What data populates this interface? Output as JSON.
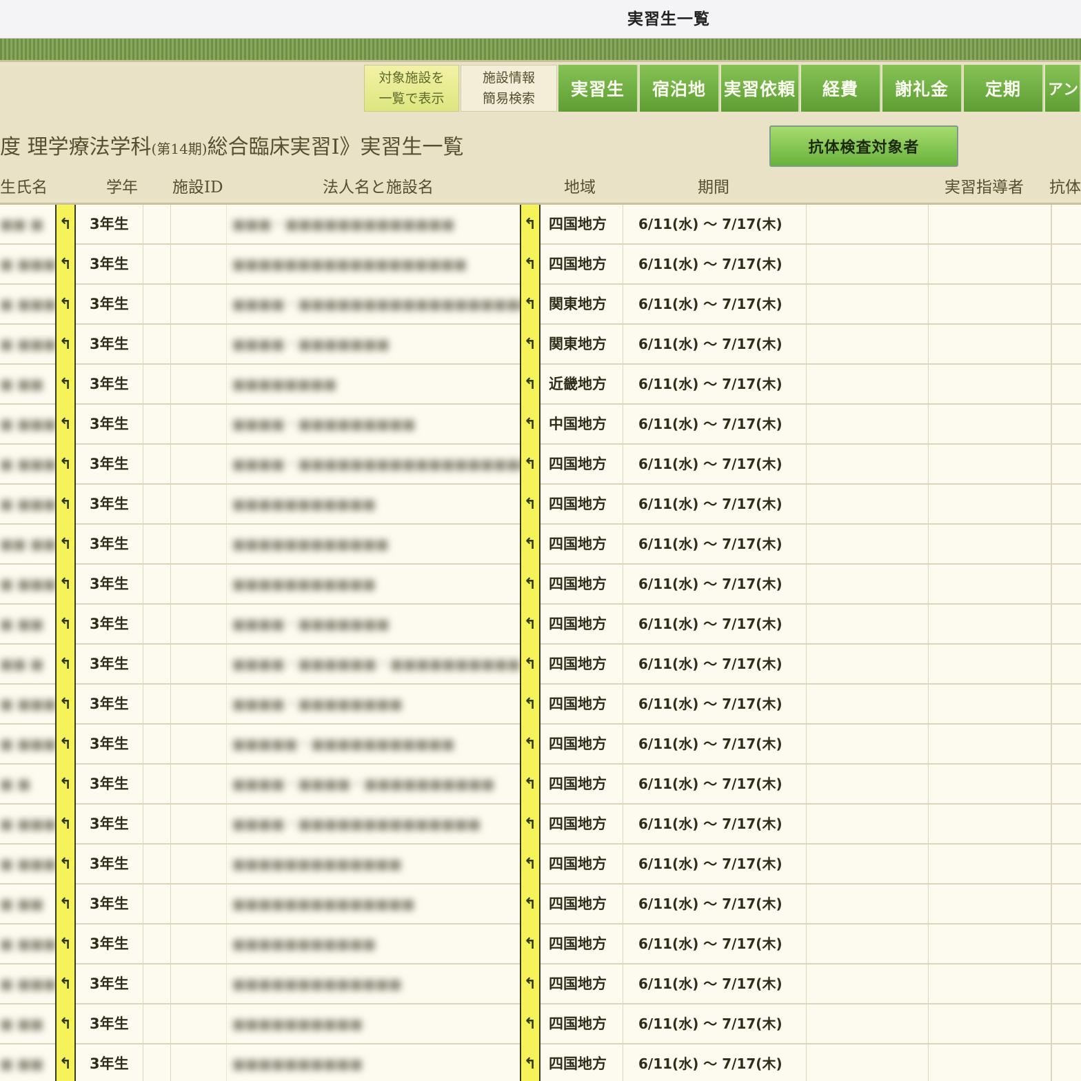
{
  "window": {
    "title": "実習生一覧"
  },
  "nav": {
    "list_facilities": "対象施設を\n一覧で表示",
    "facility_search": "施設情報\n簡易検索",
    "tabs": [
      "実習生",
      "宿泊地",
      "実習依頼",
      "経費",
      "謝礼金",
      "定期",
      "アンケ"
    ]
  },
  "heading": {
    "left": "度 理学療法学科",
    "term": "(第14期)",
    "right": "総合臨床実習Ⅰ》実習生一覧"
  },
  "antibody_button": "抗体検査対象者",
  "columns": {
    "name": "生氏名",
    "grade": "学年",
    "facility_id": "施設ID",
    "facility": "法人名と施設名",
    "region": "地域",
    "period": "期間",
    "instructor": "実習指導者",
    "antibody": "抗体"
  },
  "marker_icon": "back-arrow-icon",
  "rows": [
    {
      "name": "■■ ■",
      "grade": "3年生",
      "facility": "■■■・■■■■■■■■■■■■■",
      "region": "四国地方",
      "period": "6/11(水) 〜 7/17(木)"
    },
    {
      "name": "■ ■■■",
      "grade": "3年生",
      "facility": "■■■■■■■■■■■■■■■■■■",
      "region": "四国地方",
      "period": "6/11(水) 〜 7/17(木)"
    },
    {
      "name": "■ ■■■",
      "grade": "3年生",
      "facility": "■■■■・■■■■■■■■■■■■■■■■■■■",
      "region": "関東地方",
      "period": "6/11(水) 〜 7/17(木)"
    },
    {
      "name": "■ ■■■",
      "grade": "3年生",
      "facility": "■■■■・■■■■■■■",
      "region": "関東地方",
      "period": "6/11(水) 〜 7/17(木)"
    },
    {
      "name": "■ ■■",
      "grade": "3年生",
      "facility": "■■■■■■■■",
      "region": "近畿地方",
      "period": "6/11(水) 〜 7/17(木)"
    },
    {
      "name": "■ ■■■",
      "grade": "3年生",
      "facility": "■■■■・■■■■■■■■■",
      "region": "中国地方",
      "period": "6/11(水) 〜 7/17(木)"
    },
    {
      "name": "■ ■■■",
      "grade": "3年生",
      "facility": "■■■■・■■■■■■■■■■■■■■■■■■",
      "region": "四国地方",
      "period": "6/11(水) 〜 7/17(木)"
    },
    {
      "name": "■ ■■■",
      "grade": "3年生",
      "facility": "■■■■■■■■■■■",
      "region": "四国地方",
      "period": "6/11(水) 〜 7/17(木)"
    },
    {
      "name": "■■ ■■",
      "grade": "3年生",
      "facility": "■■■■■■■■■■■■",
      "region": "四国地方",
      "period": "6/11(水) 〜 7/17(木)"
    },
    {
      "name": "■ ■■■",
      "grade": "3年生",
      "facility": "■■■■■■■■■■■",
      "region": "四国地方",
      "period": "6/11(水) 〜 7/17(木)"
    },
    {
      "name": "■ ■■",
      "grade": "3年生",
      "facility": "■■■■・■■■■■■■",
      "region": "四国地方",
      "period": "6/11(水) 〜 7/17(木)"
    },
    {
      "name": "■■ ■",
      "grade": "3年生",
      "facility": "■■■■・■■■■■■・■■■■■■■■■■",
      "region": "四国地方",
      "period": "6/11(水) 〜 7/17(木)"
    },
    {
      "name": "■ ■■■",
      "grade": "3年生",
      "facility": "■■■■・■■■■■■■■",
      "region": "四国地方",
      "period": "6/11(水) 〜 7/17(木)"
    },
    {
      "name": "■ ■■■",
      "grade": "3年生",
      "facility": "■■■■■・■■■■■■■■■■■",
      "region": "四国地方",
      "period": "6/11(水) 〜 7/17(木)"
    },
    {
      "name": "■ ■",
      "grade": "3年生",
      "facility": "■■■■・■■■■・■■■■■■■■■■",
      "region": "四国地方",
      "period": "6/11(水) 〜 7/17(木)"
    },
    {
      "name": "■ ■■■",
      "grade": "3年生",
      "facility": "■■■■・■■■■■■■■■■■■■■",
      "region": "四国地方",
      "period": "6/11(水) 〜 7/17(木)"
    },
    {
      "name": "■ ■■■",
      "grade": "3年生",
      "facility": "■■■■■■■■■■■■■",
      "region": "四国地方",
      "period": "6/11(水) 〜 7/17(木)"
    },
    {
      "name": "■ ■■",
      "grade": "3年生",
      "facility": "■■■■■■■■■■■■■■",
      "region": "四国地方",
      "period": "6/11(水) 〜 7/17(木)"
    },
    {
      "name": "■ ■■■",
      "grade": "3年生",
      "facility": "■■■■■■■■■■■",
      "region": "四国地方",
      "period": "6/11(水) 〜 7/17(木)"
    },
    {
      "name": "■ ■■■",
      "grade": "3年生",
      "facility": "■■■■■■■■■■■■■",
      "region": "四国地方",
      "period": "6/11(水) 〜 7/17(木)"
    },
    {
      "name": "■ ■■",
      "grade": "3年生",
      "facility": "■■■■■■■■■■",
      "region": "四国地方",
      "period": "6/11(水) 〜 7/17(木)"
    },
    {
      "name": "■ ■■",
      "grade": "3年生",
      "facility": "■■■■■■■■■■",
      "region": "四国地方",
      "period": "6/11(水) 〜 7/17(木)"
    }
  ]
}
